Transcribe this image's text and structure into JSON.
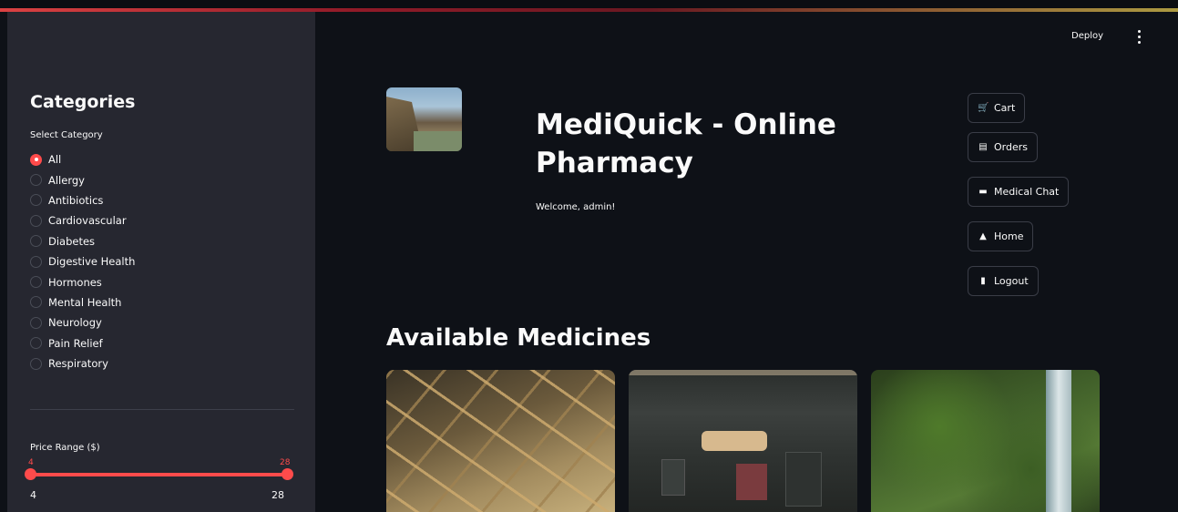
{
  "header": {
    "deploy_label": "Deploy",
    "menu_icon": "kebab-vertical-icon"
  },
  "sidebar": {
    "title": "Categories",
    "select_label": "Select Category",
    "selected": "All",
    "categories": [
      "All",
      "Allergy",
      "Antibiotics",
      "Cardiovascular",
      "Diabetes",
      "Digestive Health",
      "Hormones",
      "Mental Health",
      "Neurology",
      "Pain Relief",
      "Respiratory"
    ],
    "price": {
      "label": "Price Range ($)",
      "low_value": "4",
      "high_value": "28",
      "min_label": "4",
      "max_label": "28"
    }
  },
  "main": {
    "title": "MediQuick - Online Pharmacy",
    "welcome": "Welcome, admin!",
    "section_title": "Available Medicines",
    "nav": [
      {
        "icon": "🛒",
        "label": "Cart"
      },
      {
        "icon": "▤",
        "label": "Orders"
      },
      {
        "icon": "▬",
        "label": "Medical Chat"
      },
      {
        "icon": "▲",
        "label": "Home"
      },
      {
        "icon": "▮",
        "label": "Logout"
      }
    ]
  },
  "colors": {
    "accent": "#ff4b4b",
    "background": "#0e1117",
    "sidebar": "#262730"
  }
}
